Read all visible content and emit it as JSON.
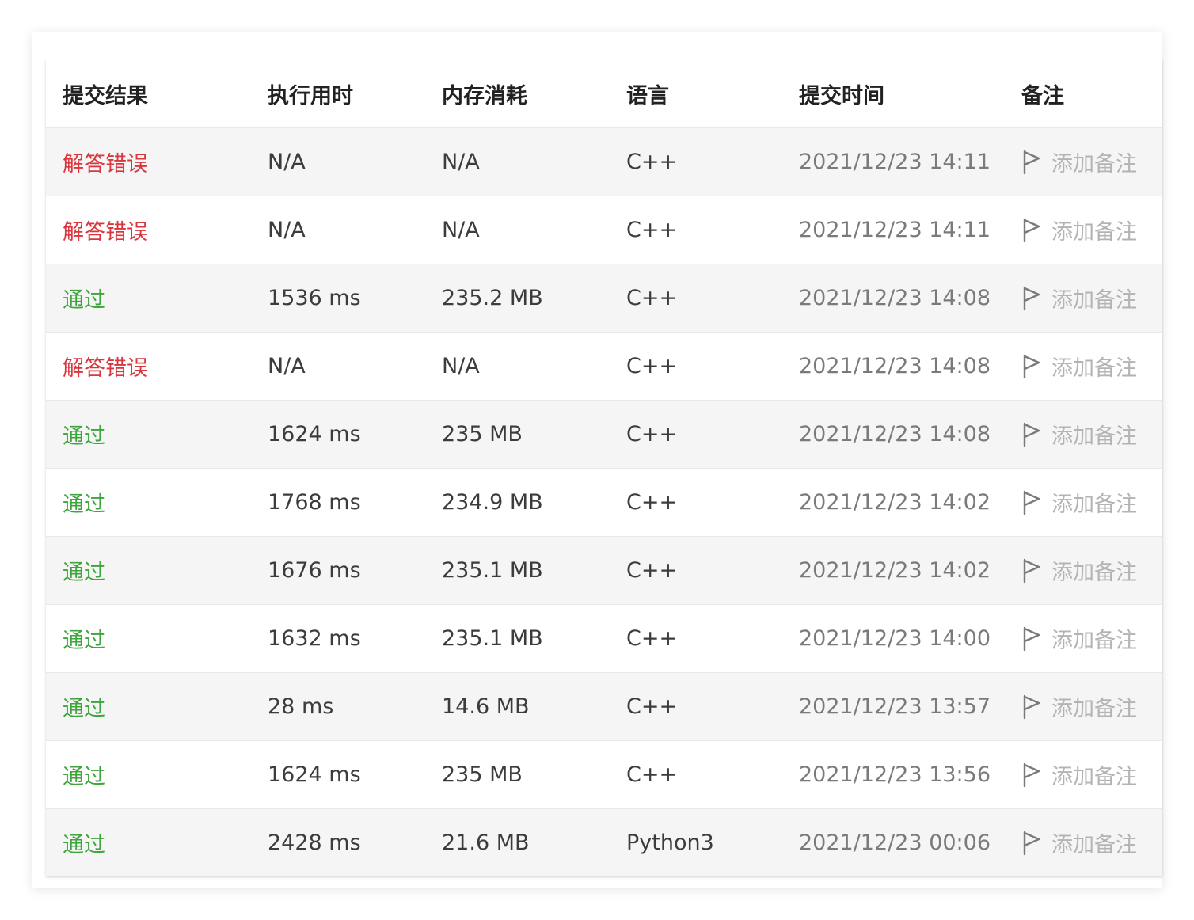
{
  "headers": {
    "result": "提交结果",
    "runtime": "执行用时",
    "memory": "内存消耗",
    "language": "语言",
    "submit_time": "提交时间",
    "note": "备注"
  },
  "colors": {
    "fail": "#d9363e",
    "pass": "#3da53b"
  },
  "rows": [
    {
      "result": "解答错误",
      "status": "fail",
      "runtime": "N/A",
      "memory": "N/A",
      "language": "C++",
      "time": "2021/12/23 14:11",
      "note": "添加备注",
      "icon": "flag-icon"
    },
    {
      "result": "解答错误",
      "status": "fail",
      "runtime": "N/A",
      "memory": "N/A",
      "language": "C++",
      "time": "2021/12/23 14:11",
      "note": "添加备注",
      "icon": "flag-icon"
    },
    {
      "result": "通过",
      "status": "pass",
      "runtime": "1536 ms",
      "memory": "235.2 MB",
      "language": "C++",
      "time": "2021/12/23 14:08",
      "note": "添加备注",
      "icon": "flag-icon"
    },
    {
      "result": "解答错误",
      "status": "fail",
      "runtime": "N/A",
      "memory": "N/A",
      "language": "C++",
      "time": "2021/12/23 14:08",
      "note": "添加备注",
      "icon": "flag-icon"
    },
    {
      "result": "通过",
      "status": "pass",
      "runtime": "1624 ms",
      "memory": "235 MB",
      "language": "C++",
      "time": "2021/12/23 14:08",
      "note": "添加备注",
      "icon": "flag-icon"
    },
    {
      "result": "通过",
      "status": "pass",
      "runtime": "1768 ms",
      "memory": "234.9 MB",
      "language": "C++",
      "time": "2021/12/23 14:02",
      "note": "添加备注",
      "icon": "flag-icon"
    },
    {
      "result": "通过",
      "status": "pass",
      "runtime": "1676 ms",
      "memory": "235.1 MB",
      "language": "C++",
      "time": "2021/12/23 14:02",
      "note": "添加备注",
      "icon": "flag-icon"
    },
    {
      "result": "通过",
      "status": "pass",
      "runtime": "1632 ms",
      "memory": "235.1 MB",
      "language": "C++",
      "time": "2021/12/23 14:00",
      "note": "添加备注",
      "icon": "flag-icon"
    },
    {
      "result": "通过",
      "status": "pass",
      "runtime": "28 ms",
      "memory": "14.6 MB",
      "language": "C++",
      "time": "2021/12/23 13:57",
      "note": "添加备注",
      "icon": "flag-icon"
    },
    {
      "result": "通过",
      "status": "pass",
      "runtime": "1624 ms",
      "memory": "235 MB",
      "language": "C++",
      "time": "2021/12/23 13:56",
      "note": "添加备注",
      "icon": "flag-icon"
    },
    {
      "result": "通过",
      "status": "pass",
      "runtime": "2428 ms",
      "memory": "21.6 MB",
      "language": "Python3",
      "time": "2021/12/23 00:06",
      "note": "添加备注",
      "icon": "flag-icon"
    }
  ]
}
